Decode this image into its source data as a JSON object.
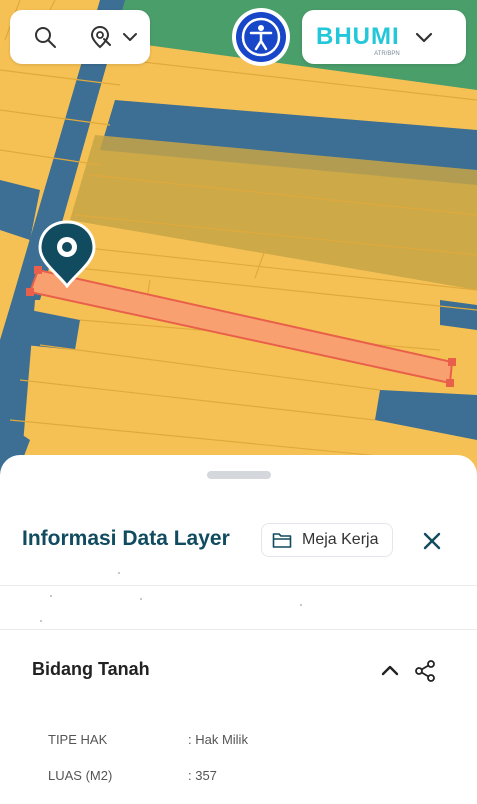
{
  "app": {
    "brand_name": "BHUMI",
    "brand_tagline": "ATR/BPN",
    "accent_color": "#114b5f",
    "brand_color": "#22c7d9"
  },
  "toolbar": {
    "search_icon": "search-icon",
    "location_filter_icon": "location-pin-search-icon",
    "dropdown_icon": "chevron-down-icon",
    "accessibility_icon": "accessibility-icon"
  },
  "map": {
    "marker_icon": "map-pin-icon",
    "selected_parcel_color": "#f8a070",
    "parcel_color": "#f6c154",
    "road_color": "#3d6e94",
    "green_area_color": "#4a9e6a"
  },
  "panel": {
    "title": "Informasi Data Layer",
    "workspace_label": "Meja Kerja",
    "section_title": "Bidang Tanah",
    "attributes": [
      {
        "label": "TIPE HAK",
        "value": ": Hak Milik"
      },
      {
        "label": "LUAS (M2)",
        "value": ": 357"
      }
    ]
  }
}
